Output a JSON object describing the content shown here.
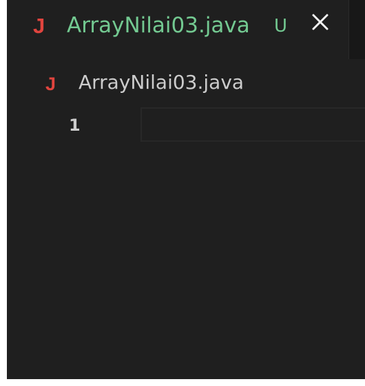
{
  "tab": {
    "icon": "java-file-icon",
    "icon_glyph": "J",
    "filename": "ArrayNilai03.java",
    "status": "U",
    "close_icon": "close-icon"
  },
  "breadcrumb": {
    "icon": "java-file-icon",
    "icon_glyph": "J",
    "filename": "ArrayNilai03.java"
  },
  "editor": {
    "line_numbers": [
      "1"
    ],
    "lines": [
      ""
    ]
  },
  "colors": {
    "background": "#1f1f1f",
    "untracked_green": "#73c991",
    "java_icon_red": "#e0443e",
    "foreground": "#cccccc"
  }
}
